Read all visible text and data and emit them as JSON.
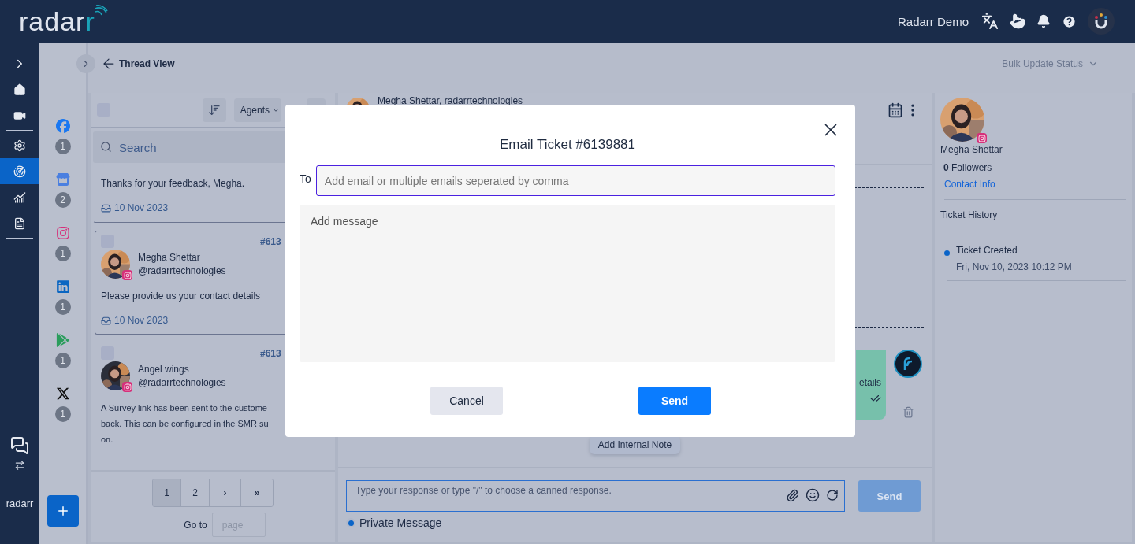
{
  "topbar": {
    "logo": "radarr",
    "user": "Radarr Demo"
  },
  "nav": {
    "groups": [
      [
        {
          "kind": "home",
          "selected": false
        },
        {
          "kind": "video",
          "selected": false
        }
      ],
      [
        {
          "kind": "settings",
          "selected": false
        },
        {
          "kind": "radar",
          "selected": true
        },
        {
          "kind": "chart",
          "selected": false
        },
        {
          "kind": "document",
          "selected": false
        }
      ]
    ],
    "footer_logo": "radarr"
  },
  "channels": [
    {
      "kind": "facebook",
      "count": "1"
    },
    {
      "kind": "store",
      "count": "2"
    },
    {
      "kind": "instagram",
      "count": "1"
    },
    {
      "kind": "linkedin",
      "count": "1"
    },
    {
      "kind": "play",
      "count": "1"
    },
    {
      "kind": "x",
      "count": "1"
    }
  ],
  "subheader": {
    "title": "Thread View",
    "bulk": "Bulk Update Status"
  },
  "list": {
    "select_all_checked": false,
    "agents": "Agents",
    "search_placeholder": "Search",
    "items": [
      {
        "kind": "partial",
        "selected": false,
        "lines": [
          "Thanks for your feedback, Megha."
        ],
        "date": "10 Nov 2023"
      },
      {
        "kind": "full",
        "selected": true,
        "checked": false,
        "ticket": "#613",
        "name": "Megha Shettar",
        "handle": "@radarrtechnologies",
        "lines": [
          "Please provide us your contact details"
        ],
        "date": "10 Nov 2023"
      },
      {
        "kind": "full",
        "selected": false,
        "checked": false,
        "ticket": "#613",
        "name": "Angel wings",
        "handle": "@radarrtechnologies",
        "lines": [
          "A Survey link has been sent to the custome",
          "back. This can be configured in the SMR su",
          "on."
        ]
      }
    ],
    "pagination": {
      "pages": [
        {
          "label": "1",
          "selected": true
        },
        {
          "label": "2",
          "selected": false
        }
      ],
      "next": "›",
      "last": "»",
      "goto": "Go to",
      "page_placeholder": "page"
    }
  },
  "thread": {
    "header_name": "Megha Shettar, radarrtechnologies",
    "message": {
      "text": "etails",
      "read": true
    },
    "internal_note": "Add Internal Note",
    "composer": {
      "placeholder": "Type your response or type \"/\" to choose a canned response.",
      "send": "Send",
      "private_label": "Private Message",
      "private_selected": true
    }
  },
  "profile": {
    "name": "Megha Shettar",
    "followers": "**0** Followers",
    "contact": "Contact Info",
    "history_title": "Ticket History",
    "history": [
      {
        "title": "Ticket Created",
        "time": "Fri, Nov 10, 2023 10:12 PM"
      }
    ]
  },
  "modal": {
    "title": "Email Ticket #6139881",
    "to_label": "To",
    "to_placeholder": "Add email or multiple emails seperated by comma",
    "message_placeholder": "Add message",
    "cancel": "Cancel",
    "send": "Send"
  }
}
